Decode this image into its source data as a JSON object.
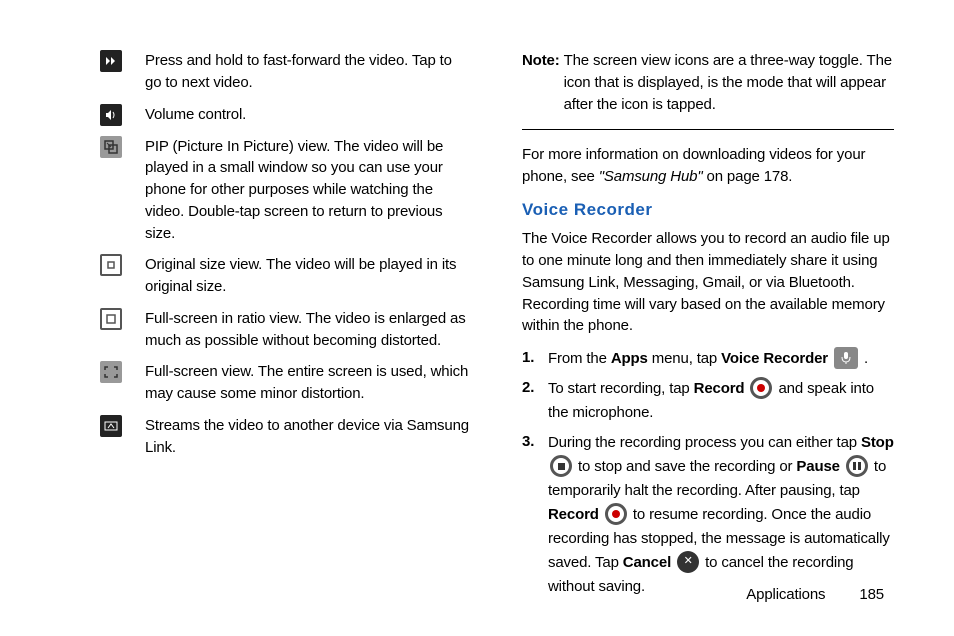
{
  "left_items": [
    {
      "icon": "fast-forward-icon",
      "text": "Press and hold to fast-forward the video. Tap to go to next video."
    },
    {
      "icon": "volume-icon",
      "text": "Volume control."
    },
    {
      "icon": "pip-icon",
      "text": "PIP (Picture In Picture) view. The video will be played in a small window so you can use your phone for other purposes while watching the video. Double-tap screen to return to previous size."
    },
    {
      "icon": "original-size-icon",
      "text": "Original size view. The video will be played in its original size."
    },
    {
      "icon": "ratio-view-icon",
      "text": "Full-screen in ratio view. The video is enlarged as much as possible without becoming distorted."
    },
    {
      "icon": "fullscreen-icon",
      "text": "Full-screen view. The entire screen is used, which may cause some minor distortion."
    },
    {
      "icon": "stream-icon",
      "text": "Streams the video to another device via Samsung Link."
    }
  ],
  "note_label": "Note:",
  "note_body": "The screen view icons are a three-way toggle. The icon that is displayed, is the mode that will appear after the icon is tapped.",
  "more_info_pre": "For more information on downloading videos for your phone, see ",
  "more_info_ref": "\"Samsung Hub\"",
  "more_info_post": " on page 178.",
  "section_title": "Voice Recorder",
  "vr_intro": "The Voice Recorder allows you to record an audio file up to one minute long and then immediately share it using Samsung Link, Messaging, Gmail, or via Bluetooth. Recording time will vary based on the available memory within the phone.",
  "steps": {
    "s1_num": "1.",
    "s1_a": "From the ",
    "s1_b": "Apps",
    "s1_c": " menu, tap ",
    "s1_d": "Voice Recorder",
    "s1_e": " .",
    "s2_num": "2.",
    "s2_a": "To start recording, tap ",
    "s2_b": "Record",
    "s2_c": " and speak into the microphone.",
    "s3_num": "3.",
    "s3_a": "During the recording process you can either tap ",
    "s3_b": "Stop",
    "s3_c": " to stop and save the recording or ",
    "s3_d": "Pause",
    "s3_e": " to temporarily halt the recording. After pausing, tap ",
    "s3_f": "Record",
    "s3_g": " to resume recording. Once the audio recording has stopped, the message is automatically saved. Tap ",
    "s3_h": "Cancel",
    "s3_i": " to cancel the recording without saving."
  },
  "footer_label": "Applications",
  "footer_page": "185"
}
